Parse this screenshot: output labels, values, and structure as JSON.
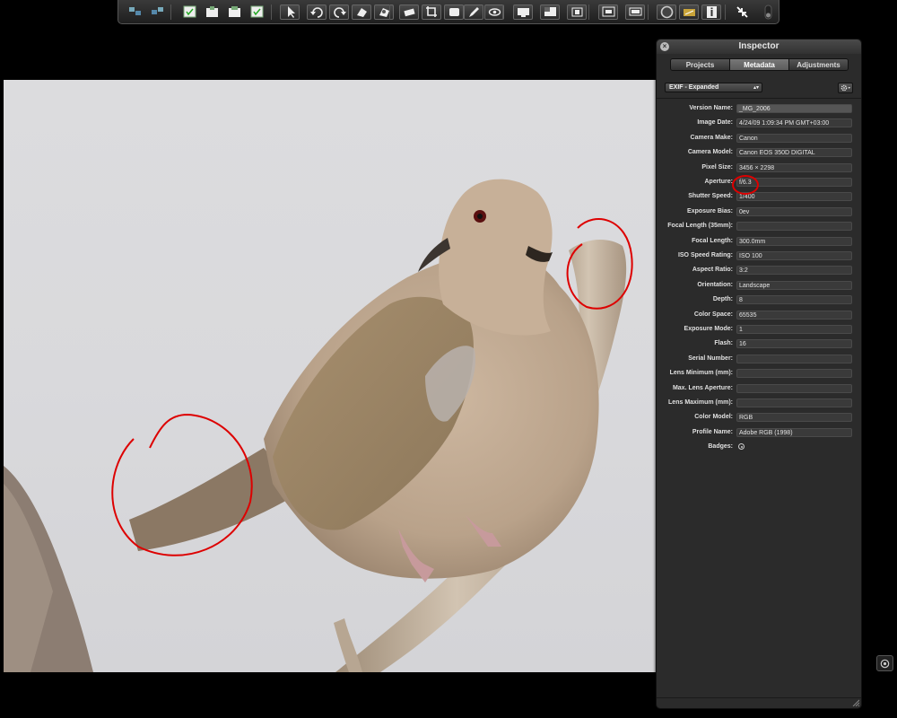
{
  "toolbar": {
    "buttons": [
      {
        "name": "split-view-icon"
      },
      {
        "name": "stack-view-icon"
      },
      {
        "name": "select-all-icon"
      },
      {
        "name": "lift-icon"
      },
      {
        "name": "stamp-icon"
      },
      {
        "name": "approve-icon"
      },
      {
        "name": "selection-tool-icon"
      },
      {
        "name": "rotate-left-icon"
      },
      {
        "name": "rotate-right-icon"
      },
      {
        "name": "lift-tool-icon"
      },
      {
        "name": "stamp-tool-icon"
      },
      {
        "name": "straighten-icon"
      },
      {
        "name": "crop-icon"
      },
      {
        "name": "spot-patch-icon"
      },
      {
        "name": "brush-icon"
      },
      {
        "name": "red-eye-icon"
      },
      {
        "name": "loupe-icon"
      },
      {
        "name": "viewer-icon"
      },
      {
        "name": "fullscreen-icon"
      },
      {
        "name": "compare-icon"
      },
      {
        "name": "filmstrip-icon"
      },
      {
        "name": "circle-icon"
      },
      {
        "name": "keywords-icon"
      },
      {
        "name": "info-icon"
      },
      {
        "name": "exit-fullscreen-icon"
      },
      {
        "name": "toggle-switch-icon"
      }
    ]
  },
  "inspector": {
    "title": "Inspector",
    "close_label": "×",
    "tabs": [
      {
        "label": "Projects",
        "active": false
      },
      {
        "label": "Metadata",
        "active": true
      },
      {
        "label": "Adjustments",
        "active": false
      }
    ],
    "preset": "EXIF - Expanded",
    "preset_arrows": "▴▾",
    "rows": [
      {
        "label": "Version Name:",
        "value": "_MG_2006"
      },
      {
        "label": "Image Date:",
        "value": "4/24/09 1:09:34 PM GMT+03:00"
      },
      {
        "label": "Camera Make:",
        "value": "Canon"
      },
      {
        "label": "Camera Model:",
        "value": "Canon EOS 350D DIGITAL"
      },
      {
        "label": "Pixel Size:",
        "value": "3456 × 2298"
      },
      {
        "label": "Aperture:",
        "value": "f/6.3"
      },
      {
        "label": "Shutter Speed:",
        "value": "1/400"
      },
      {
        "label": "Exposure Bias:",
        "value": "0ev"
      },
      {
        "label": "Focal Length (35mm):",
        "value": ""
      },
      {
        "label": "Focal Length:",
        "value": "300.0mm"
      },
      {
        "label": "ISO Speed Rating:",
        "value": "ISO 100"
      },
      {
        "label": "Aspect Ratio:",
        "value": "3:2"
      },
      {
        "label": "Orientation:",
        "value": "Landscape"
      },
      {
        "label": "Depth:",
        "value": "8"
      },
      {
        "label": "Color Space:",
        "value": "65535"
      },
      {
        "label": "Exposure Mode:",
        "value": "1"
      },
      {
        "label": "Flash:",
        "value": "16"
      },
      {
        "label": "Serial Number:",
        "value": ""
      },
      {
        "label": "Lens Minimum (mm):",
        "value": ""
      },
      {
        "label": "Max. Lens Aperture:",
        "value": ""
      },
      {
        "label": "Lens Maximum (mm):",
        "value": ""
      },
      {
        "label": "Color Model:",
        "value": "RGB"
      },
      {
        "label": "Profile Name:",
        "value": "Adobe RGB (1998)"
      },
      {
        "label": "Badges:",
        "value": ""
      }
    ]
  },
  "colors": {
    "annotation": "#dd0000",
    "dove_body": "#b9a28a",
    "branch": "#c8b8a4"
  }
}
